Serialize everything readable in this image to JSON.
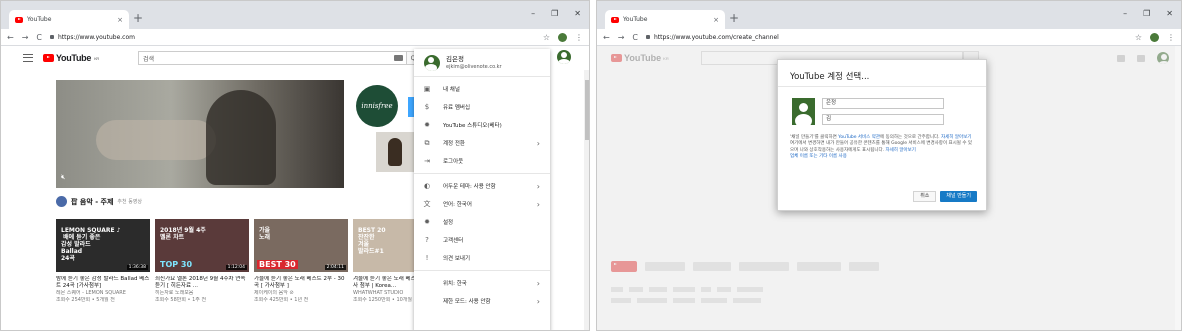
{
  "window1": {
    "tab_title": "YouTube",
    "url": "https://www.youtube.com",
    "logo_text": "YouTube",
    "logo_region": "KR",
    "search_placeholder": "검색",
    "shelf_title": "팝 음악 - 주제",
    "shelf_sub": "추천 동영상",
    "ad_brand": "innisfree",
    "videos": [
      {
        "thumb_text": "LEMON SQUARE ♪\n 배에 듣기 좋은\n감성 발라드\nBallad\n24곡",
        "duration": "1:36:38",
        "title": "밤에 듣기 좋은 감성 발라드 Ballad 베스트 24곡 [가사첨부]",
        "channel": "레몬 스퀘어 - LEMON SQUARE",
        "meta": "조회수 254만회 • 5개월 전",
        "color": "#2b2b2b"
      },
      {
        "thumb_text": "2018년 9월 4주\n멜론 차트",
        "badge": "TOP 30",
        "duration": "1:12:04",
        "title": "최신가요 멜론 2018년 9월 4주차 연속듣기 [ 히든자료 ...",
        "channel": "히든자료 노래모음",
        "meta": "조회수 58만회 • 1주 전",
        "color": "#5a3a3a"
      },
      {
        "thumb_text": "가을\n노래",
        "badge": "BEST 30",
        "duration": "2:04:11",
        "title": "가을에 듣기 좋은 노래 베스트 2부 - 30곡 [ 가사첨부 ]",
        "channel": "제이케이의 음악 ⊘",
        "meta": "조회수 425만회 • 1년 전",
        "color": "#7a6a60"
      },
      {
        "thumb_text": "BEST 20\n잔잔한\n겨울\n발라드#1",
        "duration": "",
        "title": "겨울에 듣기 좋은 노래 베스트 20곡 [ 가사 첨부 | Korea...",
        "channel": "WHATWHAT STUDIO",
        "meta": "조회수 1250만회 • 10개월 전",
        "color": "#c7b9a8"
      }
    ],
    "account": {
      "name": "김은정",
      "email": "ejkim@olivenote.co.kr"
    },
    "menu_items": [
      {
        "icon": "person-icon",
        "glyph": "▣",
        "label": "내 채널",
        "chevron": false
      },
      {
        "icon": "dollar-icon",
        "glyph": "$",
        "label": "유료 멤버십",
        "chevron": false
      },
      {
        "icon": "gear-icon",
        "glyph": "✹",
        "label": "YouTube 스튜디오(베타)",
        "chevron": false
      },
      {
        "icon": "switch-account-icon",
        "glyph": "⧉",
        "label": "계정 전환",
        "chevron": true
      },
      {
        "icon": "logout-icon",
        "glyph": "⇥",
        "label": "로그아웃",
        "chevron": false
      },
      {
        "sep": true
      },
      {
        "icon": "dark-theme-icon",
        "glyph": "◐",
        "label": "어두운 테마: 사용 안함",
        "chevron": true
      },
      {
        "icon": "language-icon",
        "glyph": "文",
        "label": "언어: 한국어",
        "chevron": true
      },
      {
        "icon": "settings-icon",
        "glyph": "✹",
        "label": "설정",
        "chevron": false
      },
      {
        "icon": "help-icon",
        "glyph": "?",
        "label": "고객센터",
        "chevron": false
      },
      {
        "icon": "feedback-icon",
        "glyph": "!",
        "label": "의견 보내기",
        "chevron": false
      },
      {
        "sep": true
      },
      {
        "icon": "",
        "glyph": "",
        "label": "위치: 한국",
        "chevron": true
      },
      {
        "icon": "",
        "glyph": "",
        "label": "제한 모드: 사용 안함",
        "chevron": true
      }
    ]
  },
  "window2": {
    "tab_title": "YouTube",
    "url": "https://www.youtube.com/create_channel",
    "logo_text": "YouTube",
    "logo_region": "KR",
    "dialog": {
      "title": "YouTube 계정 선택...",
      "first_name": "은정",
      "last_name": "김",
      "desc_1": "'채널 만들기'를 클릭하면 ",
      "desc_link_1": "YouTube 서비스 약관",
      "desc_2": "에 동의하는 것으로 간주합니다. ",
      "desc_link_2": "자세히 알아보기",
      "desc_3": "여기에서 변경하면 내가 만들어 공유한 콘텐츠를 통해 Google 서비스에 변경사항이 표시될 수 있으며 나와 상호작용하는 사용자에게도 표시됩니다. ",
      "desc_link_3": "자세히 알아보기",
      "desc_link_4": "업체 이름 또는 기타 이름 사용",
      "cancel": "취소",
      "create": "채널 만들기"
    }
  },
  "window_controls": [
    "–",
    "❐",
    "✕"
  ],
  "nav": {
    "back": "←",
    "forward": "→",
    "reload": "C"
  }
}
